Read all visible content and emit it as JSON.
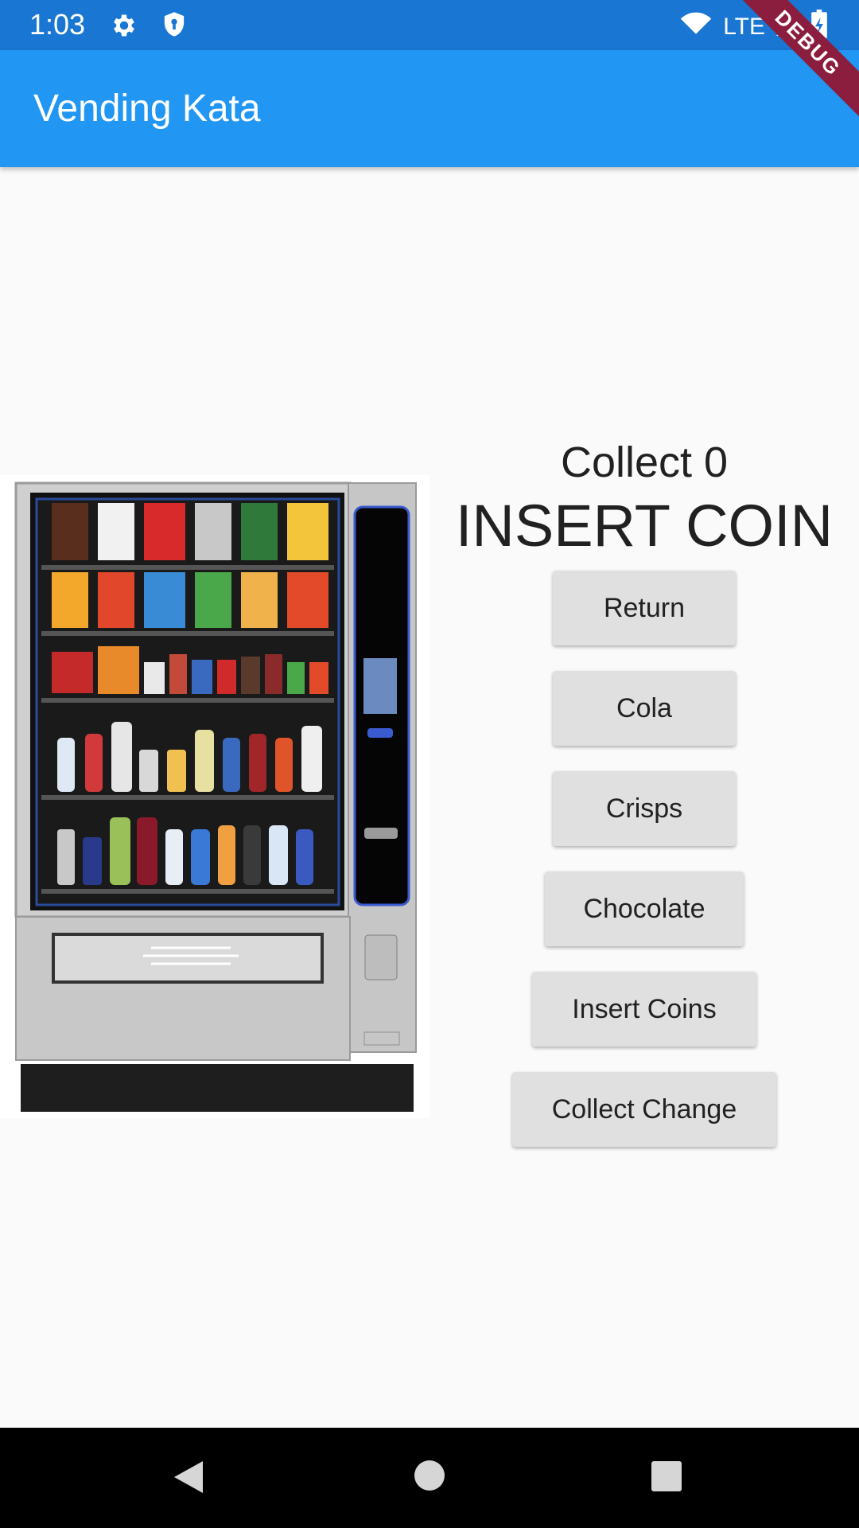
{
  "status_bar": {
    "time": "1:03",
    "network": "LTE",
    "icons": [
      "gear-icon",
      "shield-icon",
      "wifi-icon",
      "signal-icon",
      "battery-icon"
    ]
  },
  "debug_banner": "DEBUG",
  "app_bar": {
    "title": "Vending Kata",
    "color": "#2196f3"
  },
  "display": {
    "collect": "Collect 0",
    "status": "INSERT COIN"
  },
  "buttons": {
    "return": "Return",
    "cola": "Cola",
    "crisps": "Crisps",
    "chocolate": "Chocolate",
    "insert_coins": "Insert Coins",
    "collect_change": "Collect Change"
  },
  "nav_bar": {
    "icons": [
      "back-icon",
      "home-icon",
      "recents-icon"
    ]
  }
}
